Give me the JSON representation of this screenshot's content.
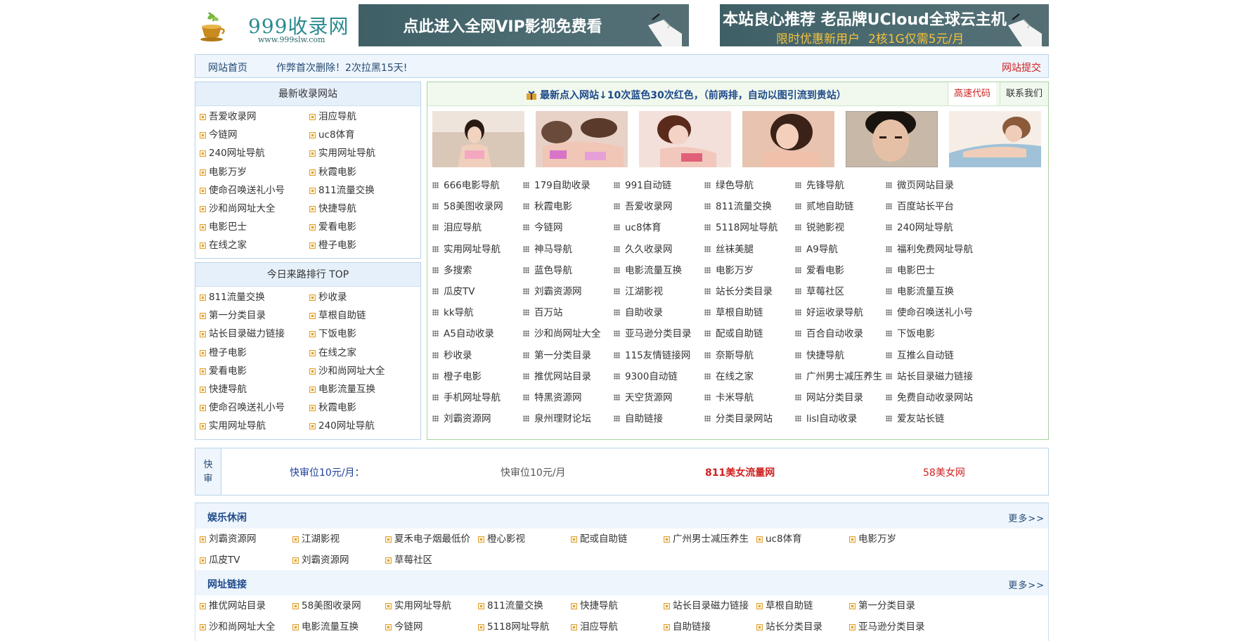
{
  "header": {
    "logo_name": "999收录网",
    "logo_url": "www.999slw.com",
    "banner1": "点此进入全网VIP影视免费看",
    "banner2_line1": "本站良心推荐 老品牌UCloud全球云主机",
    "banner2_line2a": "限时优惠新用户",
    "banner2_line2b": "2核1G仅需5元/月"
  },
  "nav": {
    "home": "网站首页",
    "notice": "作弊首次删除！2次拉黑15天!",
    "submit": "网站提交"
  },
  "latest": {
    "title": "最新收录网站",
    "items": [
      "吾爱收录网",
      "泪应导航",
      "今链网",
      "uc8体育",
      "240网址导航",
      "实用网址导航",
      "电影万岁",
      "秋霞电影",
      "使命召唤送礼小号",
      "811流量交换",
      "沙和尚网址大全",
      "快捷导航",
      "电影巴士",
      "爱看电影",
      "在线之家",
      "橙子电影"
    ]
  },
  "top_today": {
    "title": "今日来路排行 TOP",
    "items": [
      "811流量交换",
      "秒收录",
      "第一分类目录",
      "草根自助链",
      "站长目录磁力链接",
      "下饭电影",
      "橙子电影",
      "在线之家",
      "爱看电影",
      "沙和尚网址大全",
      "快捷导航",
      "电影流量互换",
      "使命召唤送礼小号",
      "秋霞电影",
      "实用网址导航",
      "240网址导航"
    ]
  },
  "main": {
    "title": "最新点入网站↓10次蓝色30次红色，（前两排，自动以图引流到贵站）",
    "tab_speed": "高速代码",
    "tab_contact": "联系我们",
    "rows": [
      [
        "666电影导航",
        "179自助收录",
        "991自动链",
        "绿色导航",
        "先锋导航",
        "微页网站目录"
      ],
      [
        "58美图收录网",
        "秋霞电影",
        "吾爱收录网",
        "811流量交换",
        "贰地自助链",
        "百度站长平台"
      ],
      [
        "泪应导航",
        "今链网",
        "uc8体育",
        "5118网址导航",
        "锐驰影视",
        "240网址导航"
      ],
      [
        "实用网址导航",
        "神马导航",
        "久久收录网",
        "丝袜美腿",
        "A9导航",
        "福利免费网址导航"
      ],
      [
        "多搜索",
        "蓝色导航",
        "电影流量互换",
        "电影万岁",
        "爱看电影",
        "电影巴士"
      ],
      [
        "瓜皮TV",
        "刘霸资源网",
        "江湖影视",
        "站长分类目录",
        "草莓社区",
        "电影流量互换"
      ],
      [
        "kk导航",
        "百万站",
        "自助收录",
        "草根自助链",
        "好运收录导航",
        "使命召唤送礼小号"
      ],
      [
        "A5自动收录",
        "沙和尚网址大全",
        "亚马逊分类目录",
        "配或自助链",
        "百合自动收录",
        "下饭电影"
      ],
      [
        "秒收录",
        "第一分类目录",
        "115友情链接网",
        "奈斯导航",
        "快捷导航",
        "互推么自动链"
      ],
      [
        "橙子电影",
        "推优网站目录",
        "9300自动链",
        "在线之家",
        "广州男士减压养生",
        "站长目录磁力链接"
      ],
      [
        "手机网址导航",
        "特黑资源网",
        "天空货源网",
        "卡米导航",
        "网站分类目录",
        "免费自动收录网站"
      ],
      [
        "刘霸资源网",
        "泉州理财论坛",
        "自助链接",
        "分类目录网站",
        "lisl自动收录",
        "爱友站长链"
      ]
    ]
  },
  "quick": {
    "label1": "快",
    "label2": "审",
    "items": [
      "快审位10元/月：",
      "快审位10元/月",
      "811美女流量网",
      "58美女网"
    ]
  },
  "categories": [
    {
      "title": "娱乐休闲",
      "more": "更多>>",
      "rows": [
        [
          "刘霸资源网",
          "江湖影视",
          "夏禾电子烟最低价",
          "橙心影视",
          "配或自助链",
          "广州男士减压养生",
          "uc8体育",
          "电影万岁"
        ],
        [
          "瓜皮TV",
          "刘霸资源网",
          "草莓社区"
        ]
      ]
    },
    {
      "title": "网址链接",
      "more": "更多>>",
      "rows": [
        [
          "推优网站目录",
          "58美图收录网",
          "实用网址导航",
          "811流量交换",
          "快捷导航",
          "站长目录磁力链接",
          "草根自助链",
          "第一分类目录"
        ],
        [
          "沙和尚网址大全",
          "电影流量互换",
          "今链网",
          "5118网址导航",
          "泪应导航",
          "自助链接",
          "站长分类目录",
          "亚马逊分类目录"
        ]
      ]
    }
  ]
}
